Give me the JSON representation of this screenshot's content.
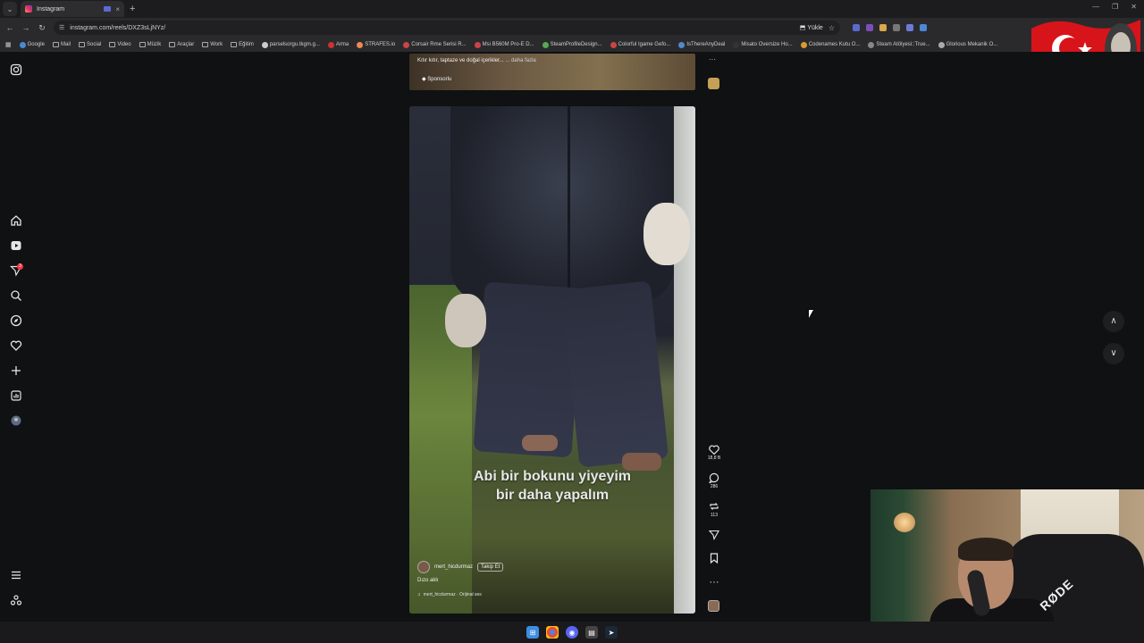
{
  "browser": {
    "tab_title": "Instagram",
    "tab_close": "×",
    "new_tab": "+",
    "url": "instagram.com/reels/DXZ3sLjNYz/",
    "install_label": "Yükle",
    "bookmarks": [
      "Google",
      "Mail",
      "Social",
      "Video",
      "Müzik",
      "Araçlar",
      "Work",
      "Eğitim",
      "parselsorgu.tkgm.g...",
      "Arma",
      "STRAFES.io",
      "Corsair Rme Serisi R...",
      "Msi B560M Pro-E D...",
      "SteamProfileDesign...",
      "Colorful Igame Gefo...",
      "IsThereAnyDeal",
      "Misato Oversize Ho...",
      "Codenames Kutu O...",
      "Steam Atölyesi::True...",
      "Glorious Mekanik O..."
    ]
  },
  "sidebar": {
    "notification_count": "3"
  },
  "ad": {
    "caption": "Kıtır kıtır, taptaze ve doğal içerikler...",
    "more_label": "daha fazla",
    "sponsored_label": "Sponsorlu",
    "more_options": "···"
  },
  "reel": {
    "subtitle_line1": "Abi bir bokunu yiyeyim",
    "subtitle_line2": "bir daha yapalım",
    "author": "mert_hicdurmaz",
    "follow_label": "Takip Et",
    "caption": "Dızo aklı",
    "audio": "mert_hicdurmaz · Orijinal ses"
  },
  "actions": {
    "likes": "18,8 B",
    "comments": "286",
    "reposts": "113",
    "more": "···"
  },
  "webcam": {
    "mic_brand": "RØDE"
  },
  "colors": {
    "background": "#0f1112",
    "badge": "#ff3040",
    "instagram_gradient": [
      "#f9a13a",
      "#e1306c",
      "#833ab4"
    ]
  }
}
